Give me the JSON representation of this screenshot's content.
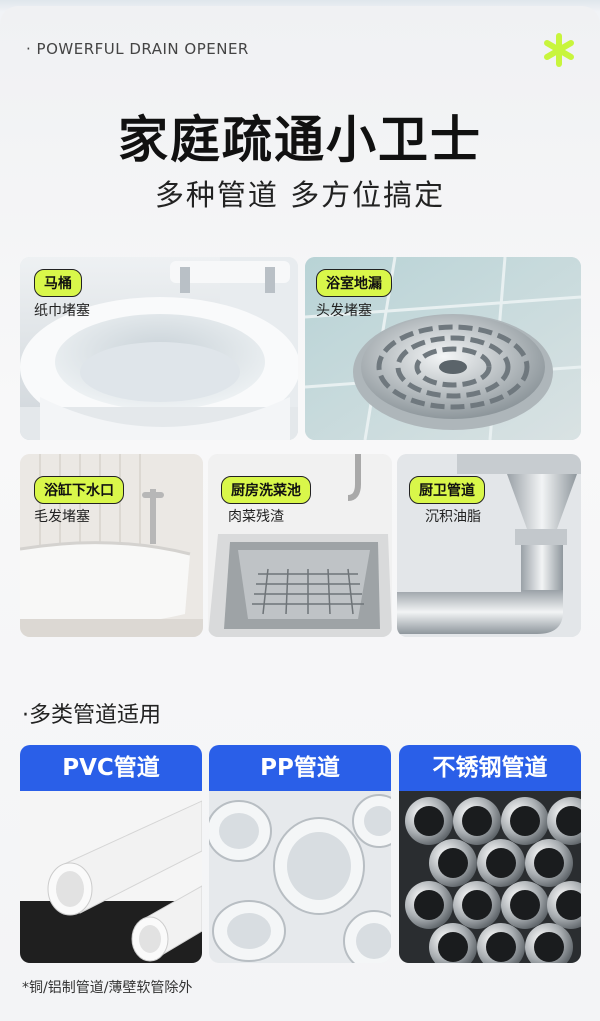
{
  "header": {
    "eyebrow": "· POWERFUL DRAIN OPENER",
    "title": "家庭疏通小卫士",
    "subtitle": "多种管道 多方位搞定",
    "star_icon": "asterisk-icon",
    "accent_color": "#c8f53c"
  },
  "scenarios": [
    {
      "tag": "马桶",
      "desc": "纸巾堵塞"
    },
    {
      "tag": "浴室地漏",
      "desc": "头发堵塞"
    },
    {
      "tag": "浴缸下水口",
      "desc": "毛发堵塞"
    },
    {
      "tag": "厨房洗菜池",
      "desc": "肉菜残渣"
    },
    {
      "tag": "厨卫管道",
      "desc": "沉积油脂"
    }
  ],
  "pipes_section": {
    "title": "·多类管道适用",
    "items": [
      {
        "label": "PVC管道"
      },
      {
        "label": "PP管道"
      },
      {
        "label": "不锈钢管道"
      }
    ],
    "header_color": "#2a5fe8",
    "note": "*铜/铝制管道/薄壁软管除外"
  }
}
